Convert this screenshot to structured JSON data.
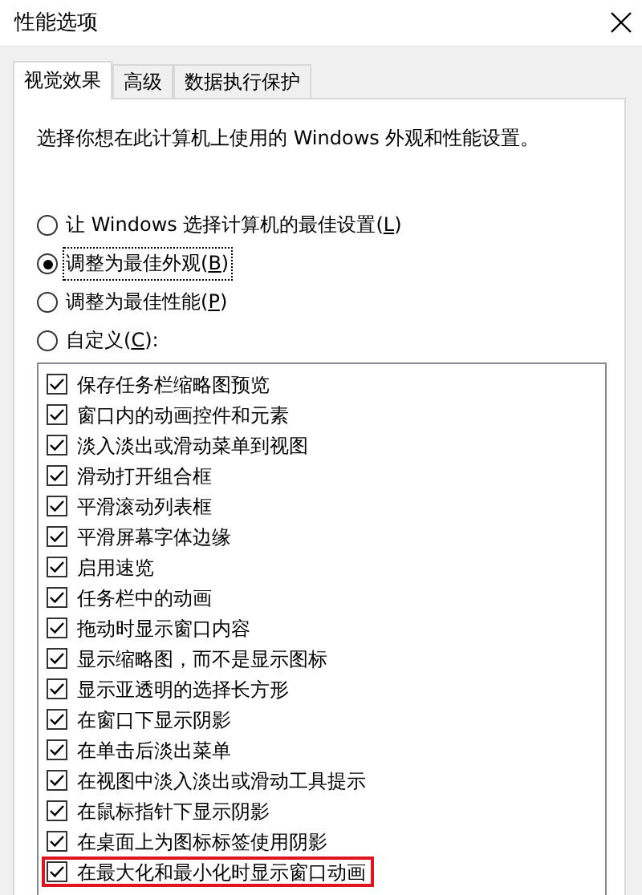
{
  "window": {
    "title": "性能选项"
  },
  "tabs": [
    {
      "label": "视觉效果",
      "selected": true
    },
    {
      "label": "高级",
      "selected": false
    },
    {
      "label": "数据执行保护",
      "selected": false
    }
  ],
  "description": "选择你想在此计算机上使用的 Windows 外观和性能设置。",
  "options": [
    {
      "label": "让 Windows 选择计算机的最佳设置(",
      "hotkey": "L",
      "label_end": ")",
      "selected": false,
      "focused": false
    },
    {
      "label": "调整为最佳外观(",
      "hotkey": "B",
      "label_end": ")",
      "selected": true,
      "focused": true
    },
    {
      "label": "调整为最佳性能(",
      "hotkey": "P",
      "label_end": ")",
      "selected": false,
      "focused": false
    },
    {
      "label": "自定义(",
      "hotkey": "C",
      "label_end": "):",
      "selected": false,
      "focused": false
    }
  ],
  "effects": [
    {
      "label": "保存任务栏缩略图预览",
      "checked": true,
      "highlighted": false
    },
    {
      "label": "窗口内的动画控件和元素",
      "checked": true,
      "highlighted": false
    },
    {
      "label": "淡入淡出或滑动菜单到视图",
      "checked": true,
      "highlighted": false
    },
    {
      "label": "滑动打开组合框",
      "checked": true,
      "highlighted": false
    },
    {
      "label": "平滑滚动列表框",
      "checked": true,
      "highlighted": false
    },
    {
      "label": "平滑屏幕字体边缘",
      "checked": true,
      "highlighted": false
    },
    {
      "label": "启用速览",
      "checked": true,
      "highlighted": false
    },
    {
      "label": "任务栏中的动画",
      "checked": true,
      "highlighted": false
    },
    {
      "label": "拖动时显示窗口内容",
      "checked": true,
      "highlighted": false
    },
    {
      "label": "显示缩略图，而不是显示图标",
      "checked": true,
      "highlighted": false
    },
    {
      "label": "显示亚透明的选择长方形",
      "checked": true,
      "highlighted": false
    },
    {
      "label": "在窗口下显示阴影",
      "checked": true,
      "highlighted": false
    },
    {
      "label": "在单击后淡出菜单",
      "checked": true,
      "highlighted": false
    },
    {
      "label": "在视图中淡入淡出或滑动工具提示",
      "checked": true,
      "highlighted": false
    },
    {
      "label": "在鼠标指针下显示阴影",
      "checked": true,
      "highlighted": false
    },
    {
      "label": "在桌面上为图标标签使用阴影",
      "checked": true,
      "highlighted": false
    },
    {
      "label": "在最大化和最小化时显示窗口动画",
      "checked": true,
      "highlighted": true
    }
  ]
}
